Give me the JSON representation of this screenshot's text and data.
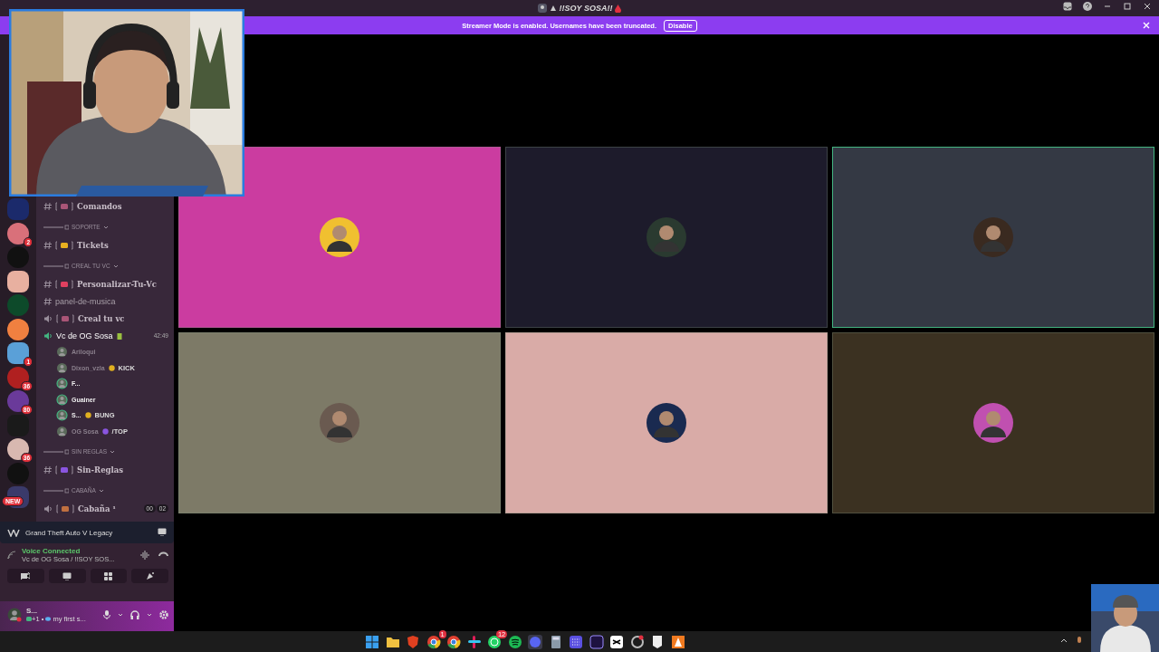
{
  "window": {
    "title": "!!SOY SOSA!!"
  },
  "banner": {
    "text": "Streamer Mode is enabled. Usernames have been truncated.",
    "button": "Disable"
  },
  "servers": [
    {
      "color": "#1b2a6b"
    },
    {
      "color": "#d9707a",
      "badge": "2"
    },
    {
      "color": "#111111"
    },
    {
      "color": "#e8b0a0"
    },
    {
      "color": "#0d4a2a"
    },
    {
      "color": "#f08040"
    },
    {
      "color": "#5aa0d8",
      "badge": "1"
    },
    {
      "color": "#b02020",
      "badge": "36"
    },
    {
      "color": "#6a3a9a",
      "badge": "80"
    },
    {
      "color": "#1a1a1a"
    },
    {
      "color": "#d8b8b0",
      "badge": "36"
    },
    {
      "color": "#111111"
    },
    {
      "color": "#3a3a6a",
      "badge": "NEW"
    }
  ],
  "channels": [
    {
      "kind": "text",
      "name": "Comandos",
      "bracketed": true
    },
    {
      "kind": "category",
      "name": "SOPORTE"
    },
    {
      "kind": "text",
      "name": "Tickets",
      "bracketed": true
    },
    {
      "kind": "category",
      "name": "CREAL TU VC"
    },
    {
      "kind": "text",
      "name": "Personalizar-Tu-Vc",
      "bracketed": true
    },
    {
      "kind": "text",
      "name": "panel-de-musica",
      "bracketed": false
    },
    {
      "kind": "voice",
      "name": "Creal tu vc",
      "bracketed": true,
      "connected": false
    },
    {
      "kind": "voice",
      "name": "Vc de OG Sosa",
      "bracketed": false,
      "connected": true,
      "time": "42:49",
      "children": [
        {
          "name": "Ariloqui",
          "speaking": false
        },
        {
          "name": "Dixon_vzla",
          "speaking": false,
          "tag": "KICK"
        },
        {
          "name": "F...",
          "speaking": true
        },
        {
          "name": "Guainer",
          "speaking": true
        },
        {
          "name": "S...",
          "speaking": true,
          "tag": "BUNG"
        },
        {
          "name": "OG Sosa",
          "speaking": false,
          "tag": "/TOP"
        }
      ]
    },
    {
      "kind": "category",
      "name": "SIN REGLAS"
    },
    {
      "kind": "text",
      "name": "Sin-Reglas",
      "bracketed": true
    },
    {
      "kind": "category",
      "name": "CABAÑA"
    },
    {
      "kind": "voice",
      "name": "Cabaña ¹",
      "bracketed": true,
      "connected": false,
      "counts": [
        "00",
        "02"
      ]
    }
  ],
  "activity": {
    "game": "Grand Theft Auto V Legacy"
  },
  "voice": {
    "status": "Voice Connected",
    "channel": "Vc de OG Sosa",
    "separator": "/",
    "server": "!!SOY SOS..."
  },
  "user": {
    "name": "S...",
    "extra": "+1",
    "dot": "•",
    "status": "my first s..."
  },
  "tiles": [
    {
      "color": "#cb3ca0",
      "speaking": false
    },
    {
      "color": "#1d1b2b",
      "speaking": false
    },
    {
      "color": "#343944",
      "speaking": true
    },
    {
      "color": "#7d7a67",
      "speaking": false
    },
    {
      "color": "#d9aba7",
      "speaking": false
    },
    {
      "color": "#3b3121",
      "speaking": false
    }
  ],
  "taskbar": [
    {
      "kind": "windows"
    },
    {
      "kind": "folder"
    },
    {
      "kind": "shield"
    },
    {
      "kind": "chrome",
      "badge": "1"
    },
    {
      "kind": "chrome"
    },
    {
      "kind": "slack"
    },
    {
      "kind": "whatsapp",
      "badge": "12"
    },
    {
      "kind": "spotify"
    },
    {
      "kind": "discord"
    },
    {
      "kind": "calculator"
    },
    {
      "kind": "grid"
    },
    {
      "kind": "premiere"
    },
    {
      "kind": "capcut"
    },
    {
      "kind": "game"
    },
    {
      "kind": "epic"
    },
    {
      "kind": "triangle"
    }
  ]
}
